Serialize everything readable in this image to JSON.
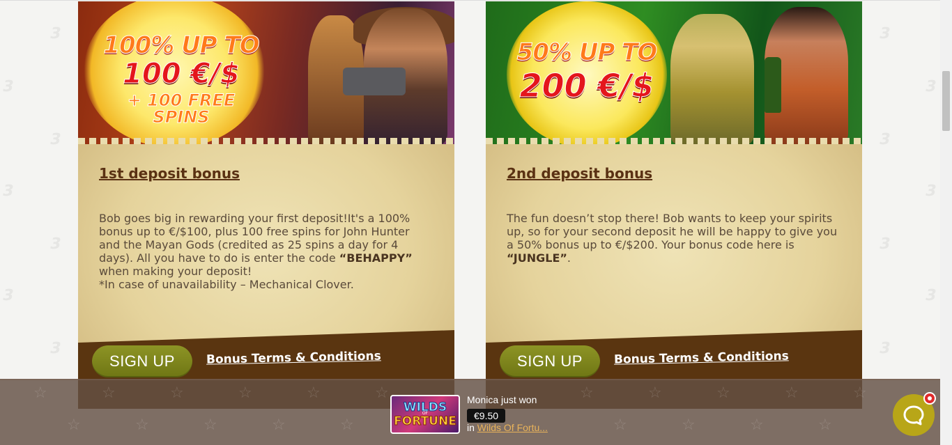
{
  "bonuses": [
    {
      "banner": {
        "line1": "100% UP TO",
        "line2": "100 €/$",
        "line3": "+ 100 FREE SPINS"
      },
      "title": "1st deposit bonus",
      "text_parts": {
        "intro": "Bob goes big in rewarding your first deposit!It's a 100% bonus up to €/$100, plus 100 free spins for John Hunter and the Mayan Gods (credited as 25 spins a day for 4 days). All you have to do is enter the code ",
        "code": "“BEHAPPY”",
        "after_code": " when making your deposit!",
        "note": "*In case of unavailability – Mechanical Clover."
      },
      "signup_label": "SIGN UP",
      "terms_label": "Bonus Terms & Conditions"
    },
    {
      "banner": {
        "line1": "50% UP TO",
        "line2": "200 €/$"
      },
      "title": "2nd deposit bonus",
      "text_parts": {
        "intro": "The fun doesn’t stop there! Bob wants to keep your spirits up, so for your second deposit he will be happy to give you a 50% bonus up to €/$200. Your bonus code here is ",
        "code": "“JUNGLE”",
        "after_code": "."
      },
      "signup_label": "SIGN UP",
      "terms_label": "Bonus Terms & Conditions"
    }
  ],
  "winner_notification": {
    "message": "Monica just won",
    "amount": "€9.50",
    "in_prefix": "in ",
    "game_name": "Wilds Of Fortu...",
    "thumbnail": {
      "line1": "WILDS",
      "line_small": "OF",
      "line2": "FORTUNE"
    }
  },
  "chat": {
    "icon": "chat-bubble-icon",
    "badge": "notification-dot"
  },
  "colors": {
    "card_background": "#e9dcae",
    "title_brown": "#5a3113",
    "footer_brown": "#5a3510",
    "signup_green": "#7c8419",
    "chat_yellow": "#b8a618",
    "winner_bar": "#64504a",
    "link_orange": "#e9b35a"
  }
}
